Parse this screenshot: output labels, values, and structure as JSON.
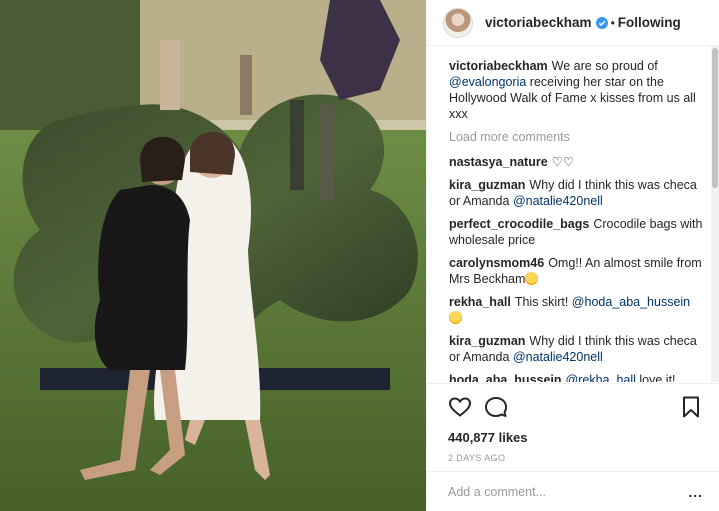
{
  "post": {
    "author": "victoriabeckham",
    "separator": "•",
    "follow_status": "Following",
    "caption_user": "victoriabeckham",
    "caption_parts": [
      "We are so proud of ",
      "@evalongoria",
      " receiving her star on the Hollywood Walk of Fame x kisses from us all xxx"
    ],
    "load_more": "Load more comments",
    "likes": "440,877 likes",
    "timestamp": "2 DAYS AGO",
    "add_comment_placeholder": "Add a comment...",
    "options": "..."
  },
  "comments": [
    {
      "user": "nastasya_nature",
      "parts": [
        "♡♡"
      ]
    },
    {
      "user": "kira_guzman",
      "parts": [
        "Why did I think this was checa or Amanda ",
        "@natalie420nell"
      ]
    },
    {
      "user": "perfect_crocodile_bags",
      "parts": [
        "Crocodile bags with wholesale price"
      ]
    },
    {
      "user": "carolynsmom46",
      "parts": [
        "Omg!! An almost smile from Mrs Beckham"
      ]
    },
    {
      "user": "rekha_hall",
      "parts": [
        "This skirt! ",
        "@hoda_aba_hussein"
      ]
    },
    {
      "user": "kira_guzman",
      "parts": [
        "Why did I think this was checa or Amanda ",
        "@natalie420nell"
      ]
    },
    {
      "user": "hoda_aba_hussein",
      "parts": [
        "@rekha_hall",
        " love it! Victoria Beckham's style..."
      ]
    }
  ],
  "icons": [
    "verified-icon",
    "heart-icon",
    "comment-icon",
    "bookmark-icon",
    "smile-emoji-icon"
  ],
  "colors": {
    "link": "#003569",
    "muted": "#999999",
    "verified": "#3897f0",
    "border": "#efefef"
  }
}
